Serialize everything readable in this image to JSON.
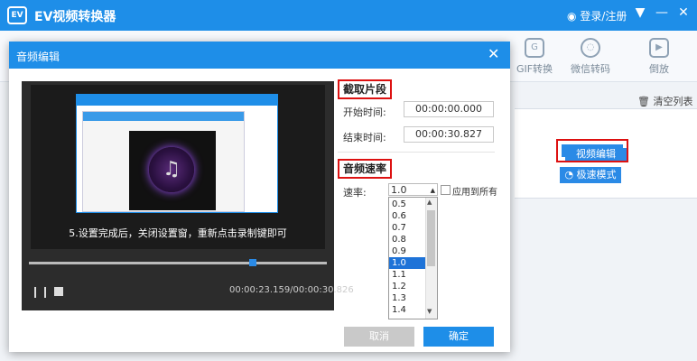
{
  "app": {
    "title": "EV视频转换器",
    "logo_text": "EV",
    "login": "登录/注册"
  },
  "toolbar": {
    "items": [
      "GIF转换",
      "微信转码",
      "倒放"
    ]
  },
  "main": {
    "clear_list": "清空列表",
    "edit_button": "视频编辑",
    "fast_mode": "极速模式"
  },
  "dialog": {
    "title": "音频编辑",
    "clip_section": "截取片段",
    "start_label": "开始时间:",
    "start_value": "00:00:00.000",
    "end_label": "结束时间:",
    "end_value": "00:00:30.827",
    "speed_section": "音频速率",
    "speed_label": "速率:",
    "speed_value": "1.0",
    "apply_all": "应用到所有",
    "speed_options": [
      "0.5",
      "0.6",
      "0.7",
      "0.8",
      "0.9",
      "1.0",
      "1.1",
      "1.2",
      "1.3",
      "1.4"
    ],
    "selected_option": "1.0",
    "cancel": "取消",
    "ok": "确定"
  },
  "player": {
    "caption": "5.设置完成后，关闭设置窗，重新点击录制键即可",
    "time": "00:00:23.159/00:00:30.826",
    "progress": 0.75
  },
  "colors": {
    "accent": "#1e8ee8",
    "highlight": "#dd1111",
    "selected": "#1e73d8"
  }
}
